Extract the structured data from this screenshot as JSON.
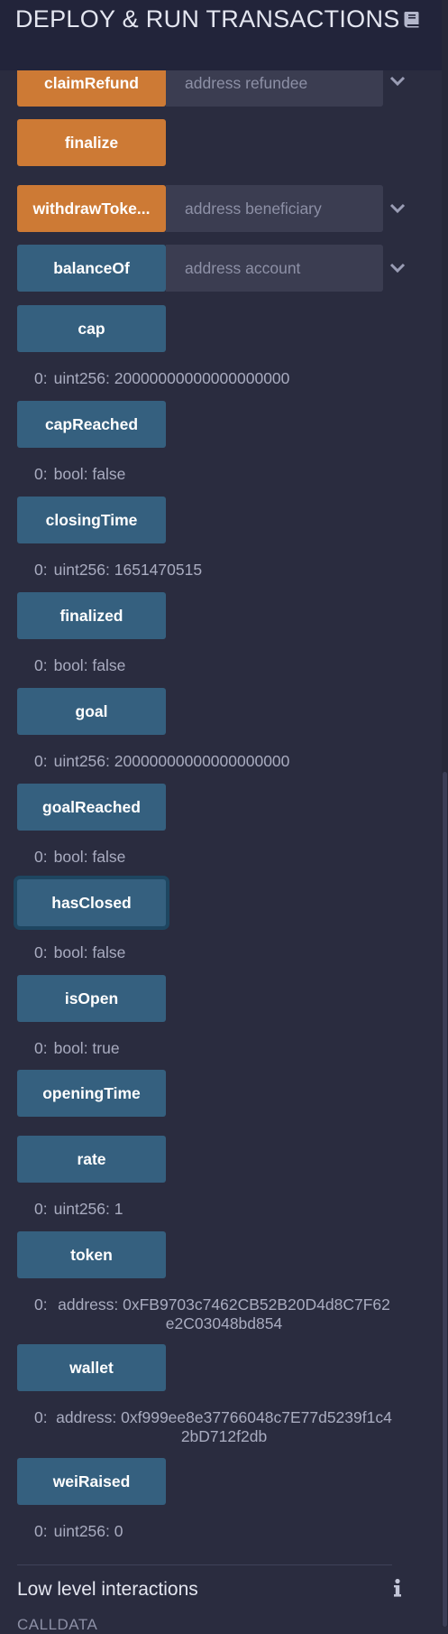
{
  "header": {
    "title": "DEPLOY & RUN TRANSACTIONS",
    "icon": "book-icon"
  },
  "functions": {
    "claimRefund": {
      "label": "claimRefund",
      "placeholder": "address refundee"
    },
    "finalize": {
      "label": "finalize"
    },
    "withdrawTokens": {
      "label": "withdrawToke...",
      "placeholder": "address beneficiary"
    },
    "balanceOf": {
      "label": "balanceOf",
      "placeholder": "address account"
    },
    "cap": {
      "label": "cap",
      "index": "0:",
      "result": "uint256: 20000000000000000000"
    },
    "capReached": {
      "label": "capReached",
      "index": "0:",
      "result": "bool: false"
    },
    "closingTime": {
      "label": "closingTime",
      "index": "0:",
      "result": "uint256: 1651470515"
    },
    "finalized": {
      "label": "finalized",
      "index": "0:",
      "result": "bool: false"
    },
    "goal": {
      "label": "goal",
      "index": "0:",
      "result": "uint256: 20000000000000000000"
    },
    "goalReached": {
      "label": "goalReached",
      "index": "0:",
      "result": "bool: false"
    },
    "hasClosed": {
      "label": "hasClosed",
      "index": "0:",
      "result": "bool: false"
    },
    "isOpen": {
      "label": "isOpen",
      "index": "0:",
      "result": "bool: true"
    },
    "openingTime": {
      "label": "openingTime"
    },
    "rate": {
      "label": "rate",
      "index": "0:",
      "result": "uint256: 1"
    },
    "token": {
      "label": "token",
      "index": "0:",
      "result": "address: 0xFB9703c7462CB52B20D4d8C7F62e2C03048bd854"
    },
    "wallet": {
      "label": "wallet",
      "index": "0:",
      "result": "address: 0xf999ee8e37766048c7E77d5239f1c42bD712f2db"
    },
    "weiRaised": {
      "label": "weiRaised",
      "index": "0:",
      "result": "uint256: 0"
    }
  },
  "low_level": {
    "title": "Low level interactions",
    "calldata_label": "CALLDATA"
  },
  "colors": {
    "background": "#2a2c3f",
    "header": "#22243a",
    "transact_button": "#cd7a35",
    "call_button": "#35607f",
    "input": "#3b3d51"
  }
}
